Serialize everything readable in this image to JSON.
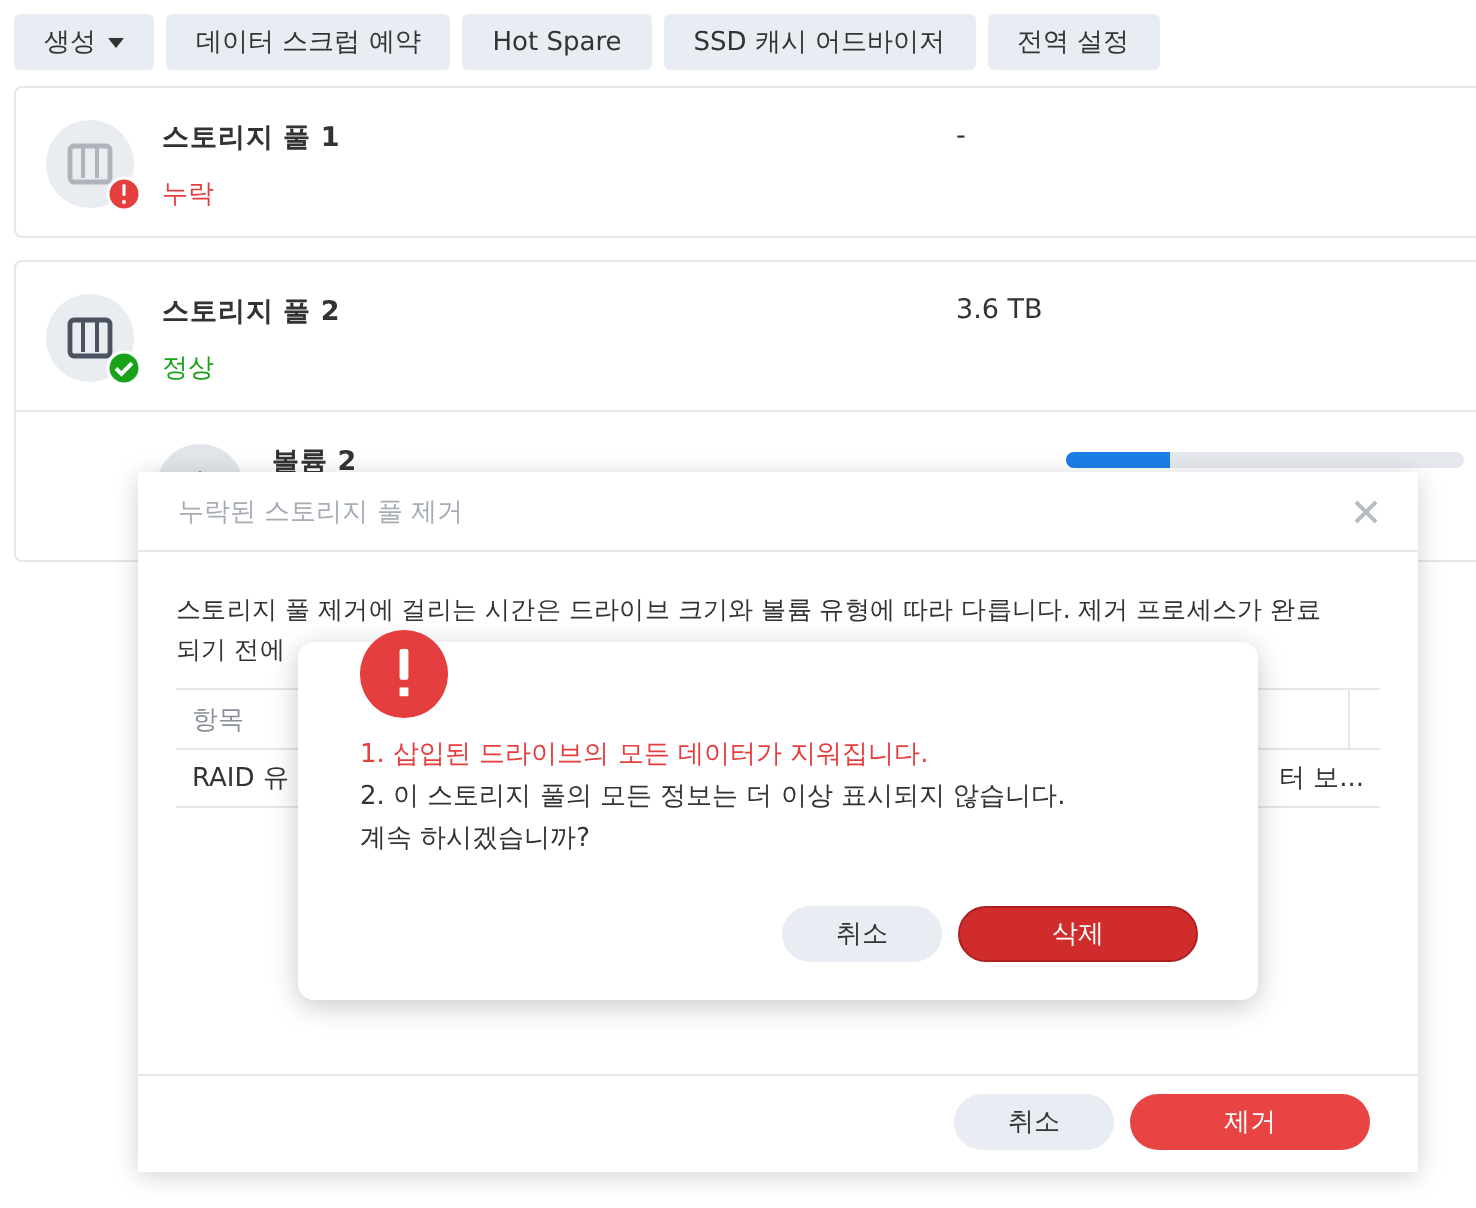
{
  "toolbar": [
    {
      "label": "생성",
      "kind": "dropdown"
    },
    {
      "label": "데이터 스크럽 예약",
      "kind": "button"
    },
    {
      "label": "Hot Spare",
      "kind": "button"
    },
    {
      "label": "SSD 캐시 어드바이저",
      "kind": "button"
    },
    {
      "label": "전역 설정",
      "kind": "button"
    }
  ],
  "pools": [
    {
      "name": "스토리지 풀 1",
      "status": "누락",
      "error": true,
      "size": "-"
    },
    {
      "name": "스토리지 풀 2",
      "status": "정상",
      "error": false,
      "size": "3.6 TB",
      "volumes": [
        {
          "name": "볼륨 2",
          "level": 0.26
        }
      ]
    }
  ],
  "dialog": {
    "title": "누락된 스토리지 풀 제거",
    "body": [
      "스토리지 풀 제거에 걸리는 시간은 드라이브 크기와 볼륨 유형에 따라 다릅니다. 제거 프로세스가 완료",
      "되기 전에"
    ],
    "table": {
      "columns": [
        "항목"
      ],
      "rows": [
        [
          "RAID 유",
          "터 보..."
        ]
      ]
    },
    "buttons": [
      {
        "label": "취소",
        "kind": "secondary"
      },
      {
        "label": "제거",
        "kind": "danger"
      }
    ]
  },
  "alert": {
    "lines": [
      {
        "text": "1. 삽입된 드라이브의 모든 데이터가 지워집니다.",
        "kind": "warning"
      },
      {
        "text": "2. 이 스토리지 풀의 모든 정보는 더 이상 표시되지 않습니다.",
        "kind": "normal"
      },
      {
        "text": "계속 하시겠습니까?",
        "kind": "normal"
      }
    ],
    "buttons": [
      {
        "label": "취소",
        "kind": "secondary"
      },
      {
        "label": "삭제",
        "kind": "danger"
      }
    ]
  }
}
